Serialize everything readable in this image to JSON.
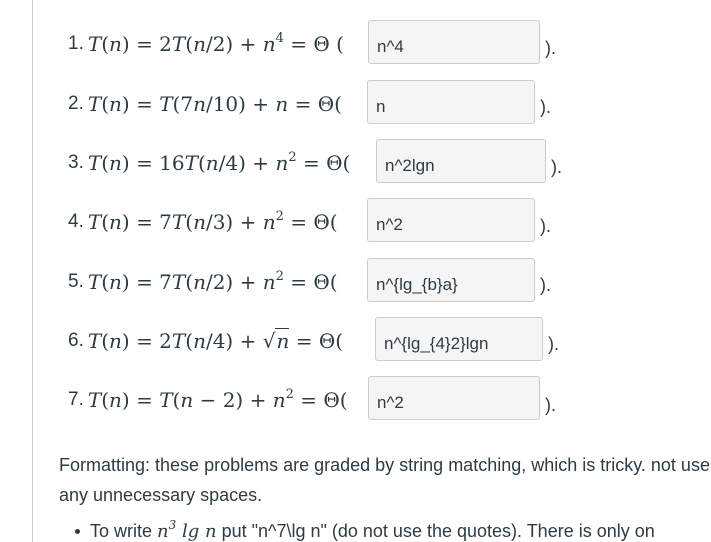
{
  "problems": [
    {
      "num": "1.",
      "answer": "n^4"
    },
    {
      "num": "2.",
      "answer": "n"
    },
    {
      "num": "3.",
      "answer": "n^2lgn"
    },
    {
      "num": "4.",
      "answer": "n^2"
    },
    {
      "num": "5.",
      "answer": "n^{lg_{b}a}"
    },
    {
      "num": "6.",
      "answer": "n^{lg_{4}2}lgn"
    },
    {
      "num": "7.",
      "answer": "n^2"
    }
  ],
  "close_paren": ").",
  "formatting_note": "Formatting:  these problems are graded by string matching, which is tricky.  not use any unnecessary spaces.",
  "bullet_prefix": "To write ",
  "bullet_rest": " put \"n^7\\lg n\" (do not use the quotes). There is only on"
}
